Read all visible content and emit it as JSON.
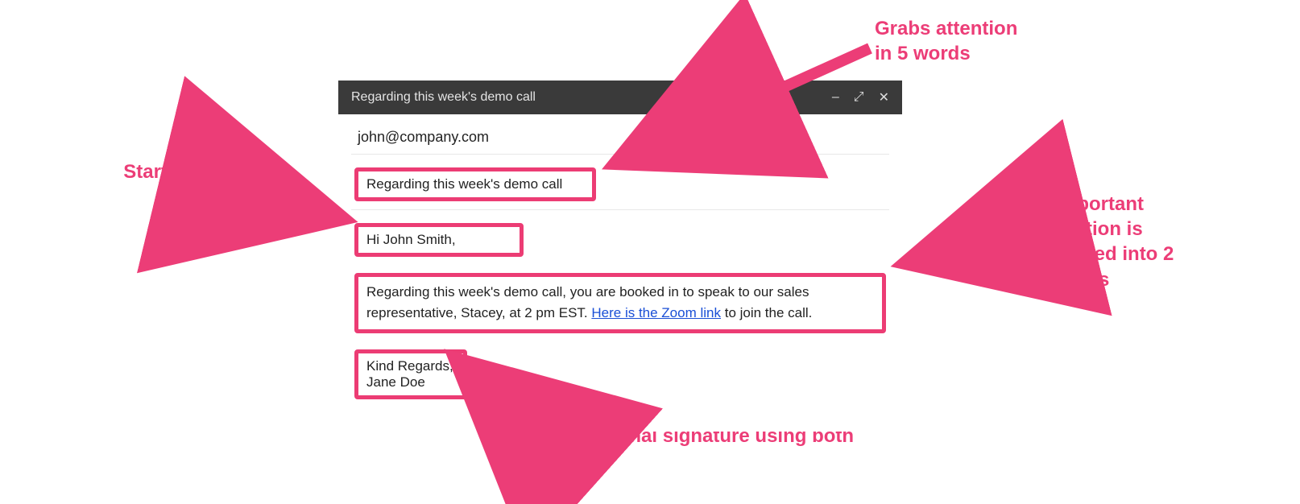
{
  "callouts": {
    "attention": "Grabs attention\nin 5 words",
    "formal": "Starts the email\nformally",
    "condensed": "The important\ninformation is\ncondensed into 2\nsentences",
    "signature": "Professional signature using both\nnames"
  },
  "compose": {
    "header_title": "Regarding this week's demo call",
    "window_controls": {
      "minimize": "minimize-icon",
      "expand": "expand-icon",
      "close": "close-icon"
    },
    "to": "john@company.com",
    "subject": "Regarding this week's demo call",
    "greeting": "Hi John Smith,",
    "body_pre": "Regarding this week's demo call, you are booked in to speak to our sales representative, Stacey, at 2 pm EST. ",
    "body_link": "Here is the Zoom link",
    "body_post": " to join the call.",
    "closing": "Kind Regards,",
    "sender": "Jane Doe"
  },
  "colors": {
    "accent": "#ec3d77",
    "header_bg": "#3a3a3a",
    "link": "#1a4fd6"
  }
}
